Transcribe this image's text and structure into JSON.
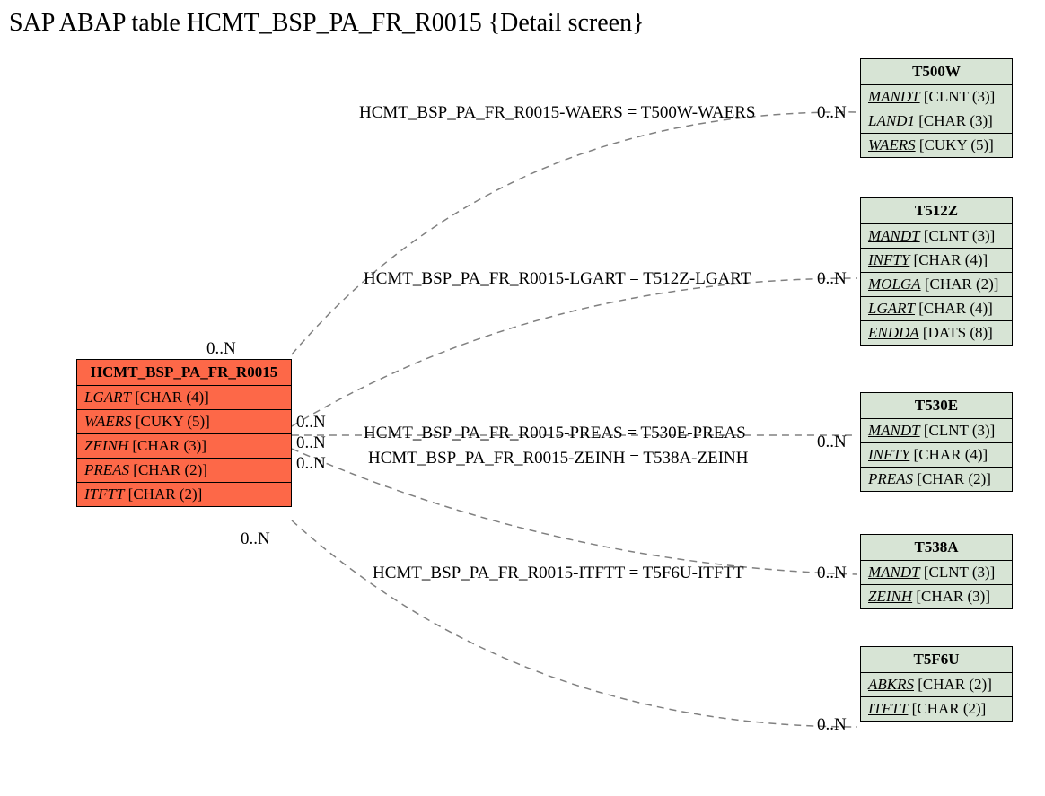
{
  "title": "SAP ABAP table HCMT_BSP_PA_FR_R0015 {Detail screen}",
  "mainEntity": {
    "name": "HCMT_BSP_PA_FR_R0015",
    "fields": [
      {
        "name": "LGART",
        "type": "[CHAR (4)]",
        "key": false
      },
      {
        "name": "WAERS",
        "type": "[CUKY (5)]",
        "key": false
      },
      {
        "name": "ZEINH",
        "type": "[CHAR (3)]",
        "key": false
      },
      {
        "name": "PREAS",
        "type": "[CHAR (2)]",
        "key": false
      },
      {
        "name": "ITFTT",
        "type": "[CHAR (2)]",
        "key": false
      }
    ]
  },
  "relatedEntities": [
    {
      "name": "T500W",
      "fields": [
        {
          "name": "MANDT",
          "type": "[CLNT (3)]",
          "key": true
        },
        {
          "name": "LAND1",
          "type": "[CHAR (3)]",
          "key": true
        },
        {
          "name": "WAERS",
          "type": "[CUKY (5)]",
          "key": true
        }
      ]
    },
    {
      "name": "T512Z",
      "fields": [
        {
          "name": "MANDT",
          "type": "[CLNT (3)]",
          "key": true
        },
        {
          "name": "INFTY",
          "type": "[CHAR (4)]",
          "key": true
        },
        {
          "name": "MOLGA",
          "type": "[CHAR (2)]",
          "key": true
        },
        {
          "name": "LGART",
          "type": "[CHAR (4)]",
          "key": true
        },
        {
          "name": "ENDDA",
          "type": "[DATS (8)]",
          "key": true
        }
      ]
    },
    {
      "name": "T530E",
      "fields": [
        {
          "name": "MANDT",
          "type": "[CLNT (3)]",
          "key": true
        },
        {
          "name": "INFTY",
          "type": "[CHAR (4)]",
          "key": true
        },
        {
          "name": "PREAS",
          "type": "[CHAR (2)]",
          "key": true
        }
      ]
    },
    {
      "name": "T538A",
      "fields": [
        {
          "name": "MANDT",
          "type": "[CLNT (3)]",
          "key": true
        },
        {
          "name": "ZEINH",
          "type": "[CHAR (3)]",
          "key": true
        }
      ]
    },
    {
      "name": "T5F6U",
      "fields": [
        {
          "name": "ABKRS",
          "type": "[CHAR (2)]",
          "key": true
        },
        {
          "name": "ITFTT",
          "type": "[CHAR (2)]",
          "key": true
        }
      ]
    }
  ],
  "relations": [
    {
      "label": "HCMT_BSP_PA_FR_R0015-WAERS = T500W-WAERS",
      "leftCard": "0..N",
      "rightCard": "0..N"
    },
    {
      "label": "HCMT_BSP_PA_FR_R0015-LGART = T512Z-LGART",
      "leftCard": "0..N",
      "rightCard": "0..N"
    },
    {
      "label": "HCMT_BSP_PA_FR_R0015-PREAS = T530E-PREAS",
      "leftCard": "0..N",
      "rightCard": "0..N"
    },
    {
      "label": "HCMT_BSP_PA_FR_R0015-ZEINH = T538A-ZEINH",
      "leftCard": "0..N",
      "rightCard": "0..N"
    },
    {
      "label": "HCMT_BSP_PA_FR_R0015-ITFTT = T5F6U-ITFTT",
      "leftCard": "0..N",
      "rightCard": "0..N"
    }
  ]
}
